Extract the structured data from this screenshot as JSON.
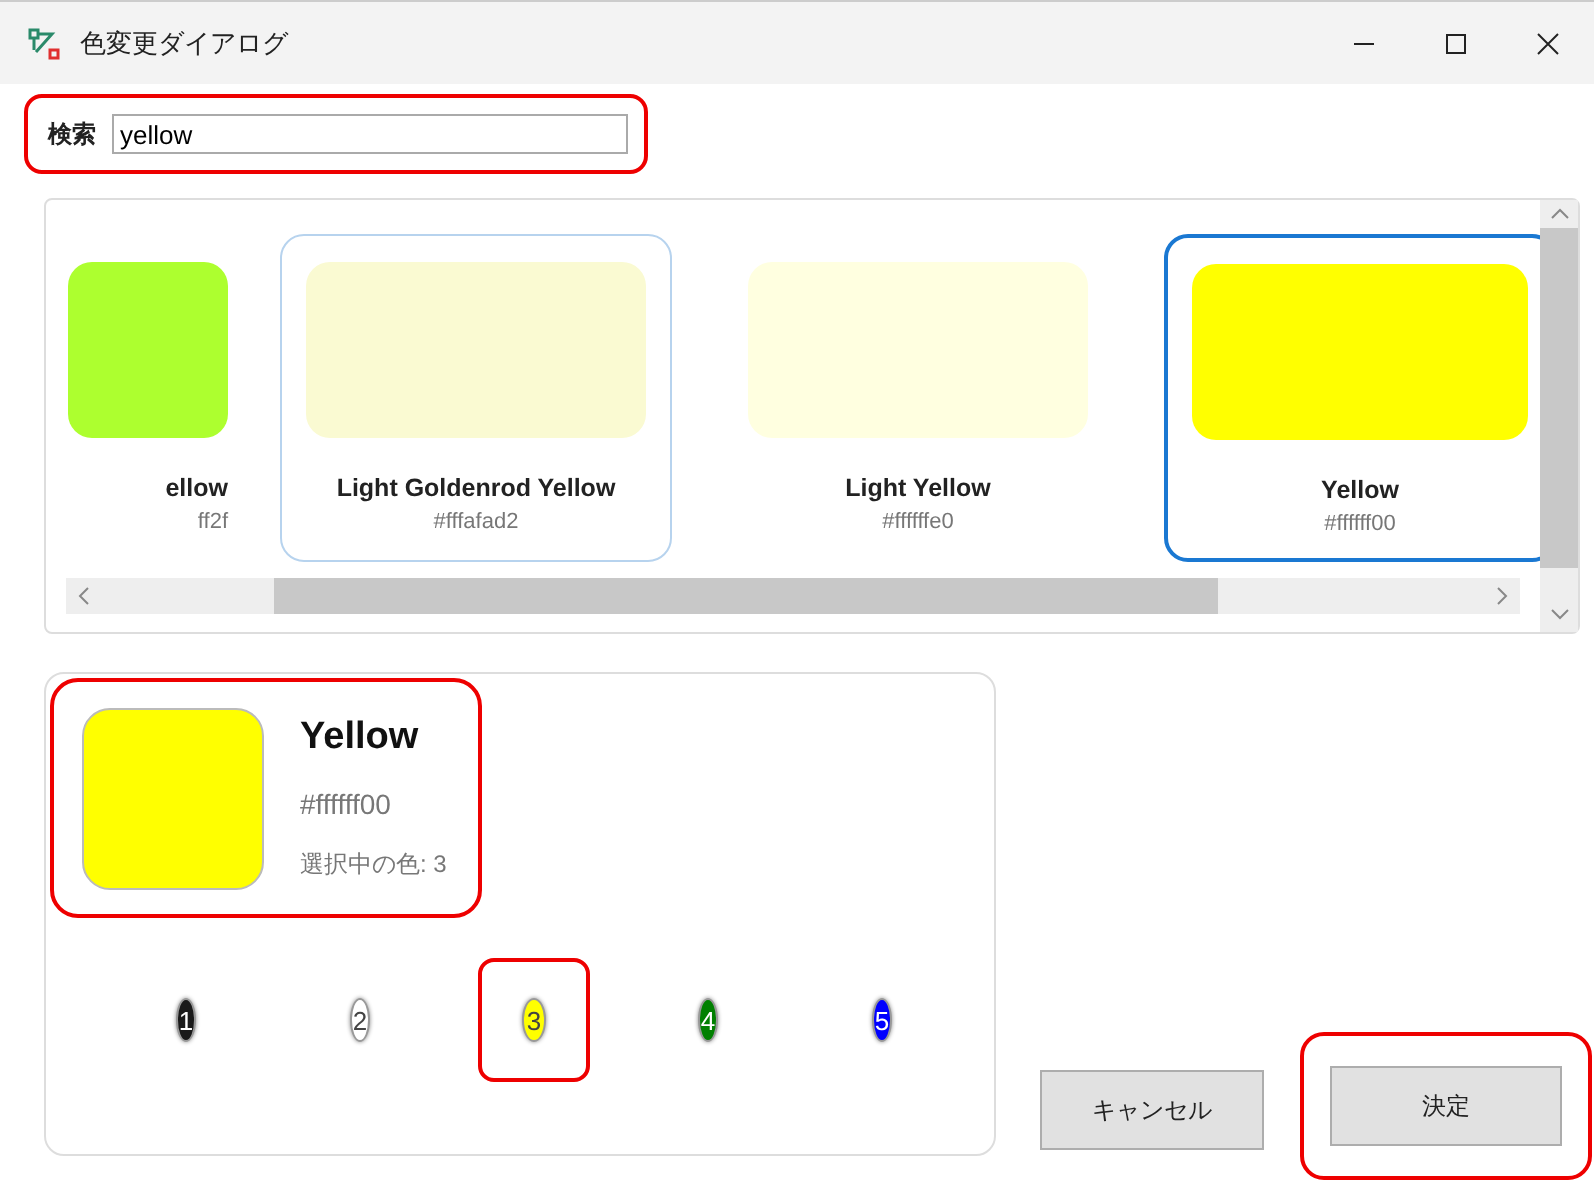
{
  "window": {
    "title": "色変更ダイアログ"
  },
  "search": {
    "label": "検索",
    "value": "yellow",
    "highlighted": true
  },
  "gallery": {
    "cards": [
      {
        "name": "ellow",
        "hex": "ff2f",
        "color": "#adff2f",
        "selected": false,
        "hovered": false,
        "partial": true
      },
      {
        "name": "Light Goldenrod Yellow",
        "hex": "#fffafad2",
        "color": "#fafad2",
        "selected": false,
        "hovered": true,
        "partial": false
      },
      {
        "name": "Light Yellow",
        "hex": "#ffffffe0",
        "color": "#ffffe0",
        "selected": false,
        "hovered": false,
        "partial": false
      },
      {
        "name": "Yellow",
        "hex": "#ffffff00",
        "color": "#ffff00",
        "selected": true,
        "hovered": false,
        "partial": false
      }
    ]
  },
  "preview": {
    "name": "Yellow",
    "hex": "#ffffff00",
    "color": "#ffff00",
    "slot_text": "選択中の色: 3",
    "highlighted": true
  },
  "slots": [
    {
      "label": "1",
      "color": "#1a1a1a",
      "selected": false,
      "highlighted": false
    },
    {
      "label": "2",
      "color": "#ffffff",
      "selected": false,
      "highlighted": false
    },
    {
      "label": "3",
      "color": "#ffff00",
      "selected": true,
      "highlighted": true
    },
    {
      "label": "4",
      "color": "#008000",
      "selected": false,
      "highlighted": false
    },
    {
      "label": "5",
      "color": "#0000ff",
      "selected": false,
      "highlighted": false
    }
  ],
  "buttons": [
    {
      "label": "キャンセル",
      "highlighted": false
    },
    {
      "label": "決定",
      "highlighted": true
    }
  ]
}
